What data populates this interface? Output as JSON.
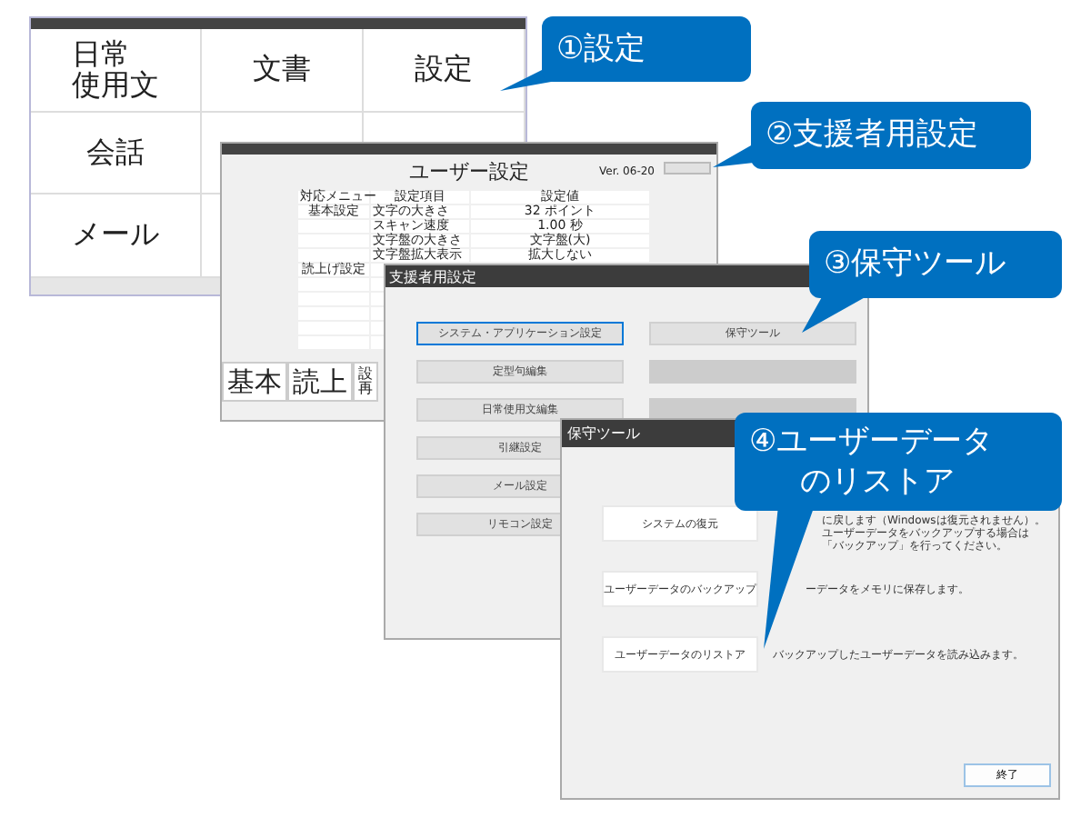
{
  "main_menu": {
    "cells": [
      {
        "lines": [
          "日常",
          "使用文"
        ]
      },
      {
        "lines": [
          "文書"
        ]
      },
      {
        "lines": [
          "設定"
        ]
      },
      {
        "lines": [
          "会話"
        ]
      },
      {},
      {},
      {
        "lines": [
          "メール"
        ]
      },
      {},
      {}
    ]
  },
  "user_settings": {
    "title": "ユーザー設定",
    "version": "Ver. 06-20",
    "columns": [
      "対応メニュー",
      "設定項目",
      "設定値"
    ],
    "rows": [
      {
        "menu": "基本設定",
        "item": "文字の大きさ",
        "value": "32 ポイント"
      },
      {
        "item": "スキャン速度",
        "value": "1.00 秒"
      },
      {
        "item": "文字盤の大きさ",
        "value": "文字盤(大)"
      },
      {
        "item": "文字盤拡大表示",
        "value": "拡大しない"
      },
      {
        "menu": "読上げ設定"
      },
      {},
      {},
      {},
      {},
      {}
    ],
    "tabs": [
      {
        "label": "基本"
      },
      {
        "label": "読上"
      },
      {
        "lines": [
          "設",
          "再"
        ]
      }
    ]
  },
  "support_settings": {
    "title": "支援者用設定",
    "left_buttons": [
      {
        "label": "システム・アプリケーション設定",
        "selected": true
      },
      {
        "label": "定型句編集",
        "selected": false
      },
      {
        "label": "日常使用文編集",
        "selected": false
      },
      {
        "label": "引継設定",
        "selected": false
      },
      {
        "label": "メール設定",
        "selected": false
      },
      {
        "label": "リモコン設定",
        "selected": false
      }
    ],
    "right_buttons": [
      {
        "label": "保守ツール",
        "disabled": false
      },
      {
        "disabled": true
      },
      {
        "disabled": true
      }
    ]
  },
  "maintenance_tool": {
    "title": "保守ツール",
    "actions": [
      {
        "button": "システムの復元",
        "description": [
          "に戻します（Windowsは復元されません）。",
          "ユーザーデータをバックアップする場合は",
          "「バックアップ」を行ってください。"
        ]
      },
      {
        "button": "ユーザーデータのバックアップ",
        "description": [
          "ーデータをメモリに保存します。"
        ]
      },
      {
        "button": "ユーザーデータのリストア",
        "description": [
          "バックアップしたユーザーデータを読み込みます。"
        ]
      }
    ],
    "close_button": "終了"
  },
  "callouts": [
    {
      "lines": [
        "①設定"
      ]
    },
    {
      "lines": [
        "②支援者用設定"
      ]
    },
    {
      "lines": [
        "③保守ツール"
      ]
    },
    {
      "lines": [
        "④ユーザーデータ",
        "のリストア"
      ]
    }
  ]
}
